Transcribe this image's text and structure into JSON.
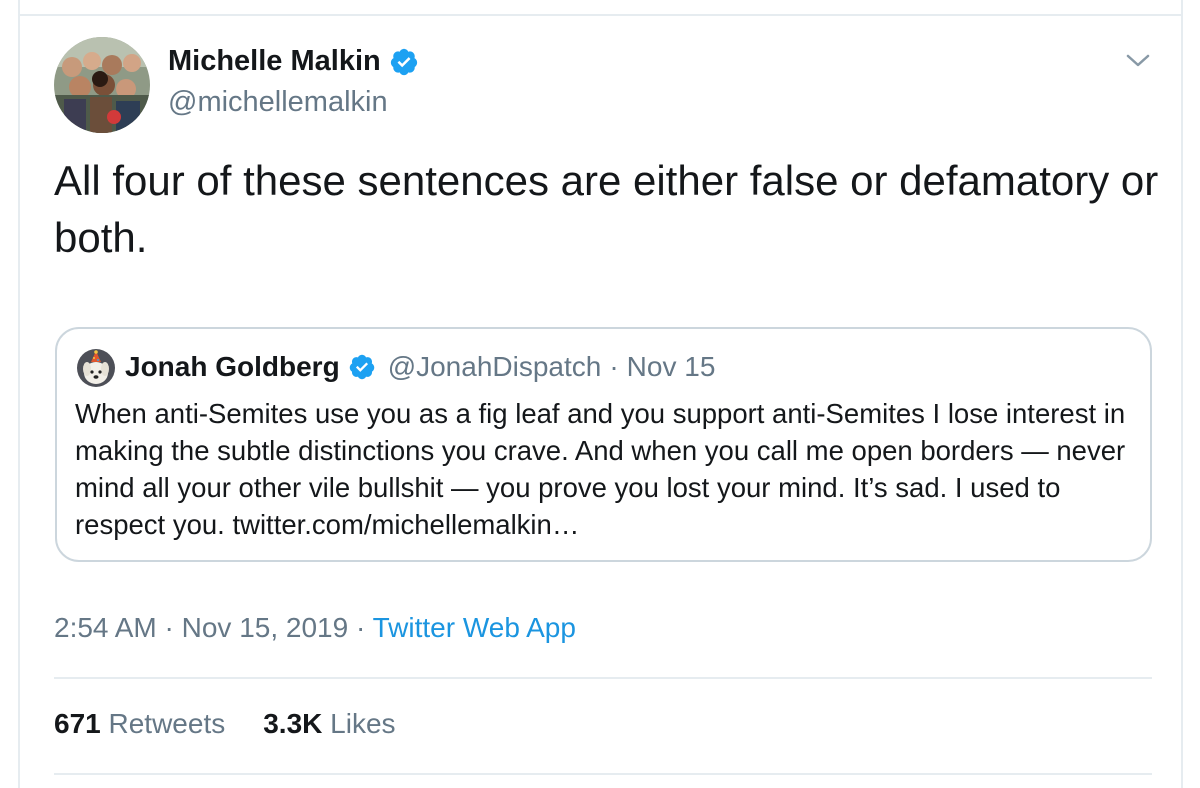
{
  "tweet": {
    "author_name": "Michelle Malkin",
    "author_handle": "@michellemalkin",
    "text": "All four of these sentences are either false or defamatory or both.",
    "verified_icon": "verified-badge-icon",
    "menu_icon": "chevron-down-icon"
  },
  "quote": {
    "author_name": "Jonah Goldberg",
    "author_handle": "@JonahDispatch",
    "separator": "·",
    "date": "Nov 15",
    "text": "When anti-Semites use you as a fig leaf and you support anti-Semites I lose interest in making the subtle distinctions you crave. And when you call me open borders — never mind all your other vile bullshit — you prove you lost your mind. It’s sad. I used to respect you. twitter.com/michellemalkin…"
  },
  "meta": {
    "time": "2:54 AM",
    "separator": "·",
    "date": "Nov 15, 2019",
    "source": "Twitter Web App"
  },
  "stats": {
    "retweets_count": "671",
    "retweets_label": "Retweets",
    "likes_count": "3.3K",
    "likes_label": "Likes"
  },
  "colors": {
    "link_blue": "#1b95e0",
    "verified_blue": "#1da1f2",
    "secondary_text": "#657786",
    "border": "#e6ecf0"
  }
}
